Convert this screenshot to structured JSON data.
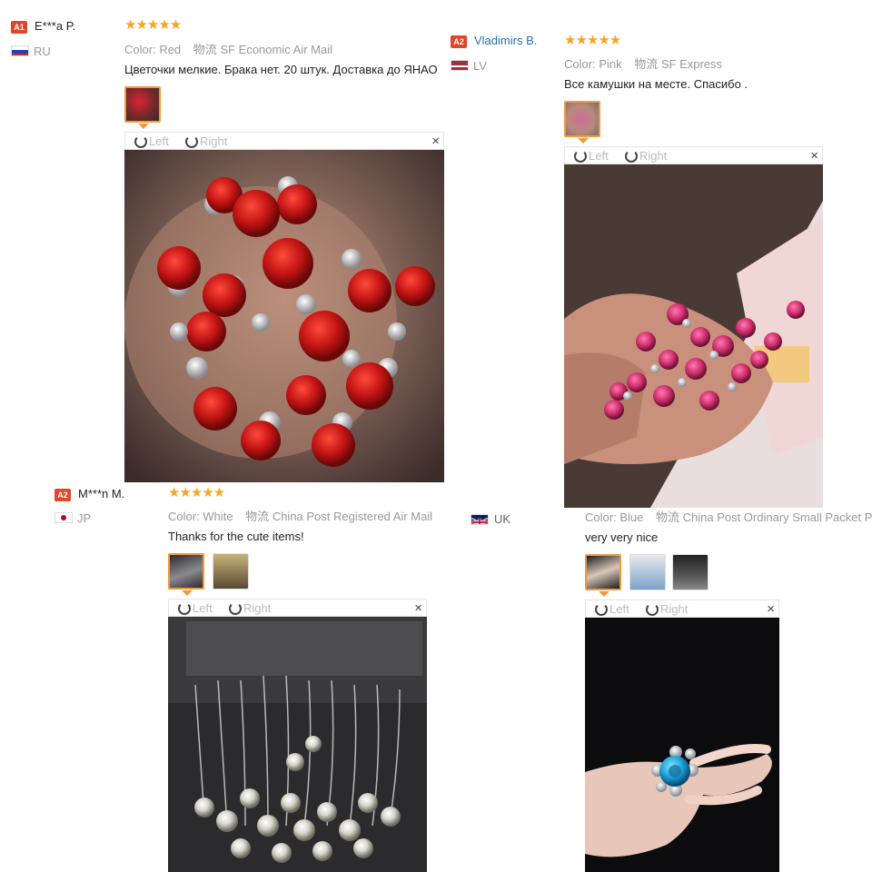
{
  "reviews": [
    {
      "badge": "A1",
      "badge_color": "#e0462a",
      "name": "E***a P.",
      "country": "RU",
      "flag": "russia-flag-icon",
      "stars": "★★★★★",
      "color_label": "Color:",
      "color_value": "Red",
      "logistics_label": "物流",
      "shipping": "SF Economic Air Mail",
      "text": "Цветочки мелкие. Брака нет. 20 штук. Доставка до ЯНАО",
      "viewer": {
        "left": "Left",
        "right": "Right",
        "close": "×"
      }
    },
    {
      "badge": "A2",
      "badge_color": "#e0462a",
      "name": "Vladimirs B.",
      "country": "LV",
      "flag": "latvia-flag-icon",
      "stars": "★★★★★",
      "color_label": "Color:",
      "color_value": "Pink",
      "logistics_label": "物流",
      "shipping": "SF Express",
      "text": "Все камушки на месте. Спасибо .",
      "viewer": {
        "left": "Left",
        "right": "Right",
        "close": "×"
      }
    },
    {
      "badge": "A2",
      "badge_color": "#e0462a",
      "name": "M***n M.",
      "country": "JP",
      "flag": "japan-flag-icon",
      "stars": "★★★★★",
      "color_label": "Color:",
      "color_value": "White",
      "logistics_label": "物流",
      "shipping": "China Post Registered Air Mail",
      "text": "Thanks for the cute items!",
      "viewer": {
        "left": "Left",
        "right": "Right",
        "close": "×"
      }
    },
    {
      "country": "UK",
      "flag": "uk-flag-icon",
      "color_label": "Color:",
      "color_value": "Blue",
      "logistics_label": "物流",
      "shipping": "China Post Ordinary Small Packet Plus",
      "text": "very very nice",
      "viewer": {
        "left": "Left",
        "right": "Right",
        "close": "×"
      }
    }
  ],
  "colors": {
    "star": "#f5a623",
    "selected_border": "#f09a3a",
    "link": "#2a6fb0"
  }
}
